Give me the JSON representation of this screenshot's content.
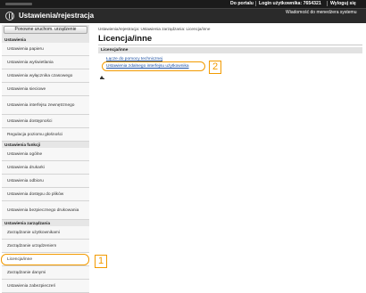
{
  "topbar": {
    "portal_label": "Do portalu",
    "login_label": "Login użytkownika:  7654321",
    "logout_label": "Wyloguj się",
    "manager_mail": "Wiadomość do menedżera systemu"
  },
  "header": {
    "title": "Ustawienia/rejestracja"
  },
  "sidebar": {
    "restart_button": "Ponowne uruchom. urządzenie",
    "section_settings": "Ustawienia",
    "items_settings": [
      "Ustawienia papieru",
      "Ustawienia wyświetlania",
      "Ustawienia wyłącznika czasowego",
      "Ustawienia sieciowe",
      "Ustawienia interfejsu zewnętrznego",
      "Ustawienia dostępności",
      "Regulacja poziomu głośności"
    ],
    "section_functions": "Ustawienia funkcji",
    "items_functions": [
      "Ustawienia ogólne",
      "Ustawienia drukarki",
      "Ustawienia odbioru",
      "Ustawienia dostępu do plików",
      "Ustawienia bezpiecznego drukowania"
    ],
    "section_management": "Ustawienia zarządzania",
    "items_management": [
      "Zarządzanie użytkownikami",
      "Zarządzanie urządzeniem",
      "Licencja/inne",
      "Zarządzanie danymi",
      "Ustawienia zabezpieczeń"
    ]
  },
  "main": {
    "breadcrumb": "Ustawienia/rejestracja: Ustawienia zarządzania: Licencja/inne",
    "title": "Licencja/inne",
    "section_label": "Licencja/inne",
    "link_support": "Łącze do pomocy technicznej",
    "link_remote_ui": "Ustawienia zdalnego interfejsu użytkownika"
  },
  "callouts": {
    "one": "1",
    "two": "2"
  },
  "colors": {
    "callout": "#f29a00",
    "topbar": "#1b1b1b",
    "link": "#1a4fa3"
  }
}
